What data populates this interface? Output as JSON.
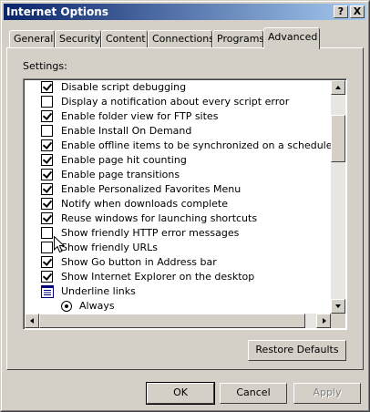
{
  "window": {
    "title": "Internet Options",
    "help_label": "?",
    "close_label": "X"
  },
  "tabs": [
    {
      "label": "General",
      "active": false
    },
    {
      "label": "Security",
      "active": false
    },
    {
      "label": "Content",
      "active": false
    },
    {
      "label": "Connections",
      "active": false
    },
    {
      "label": "Programs",
      "active": false
    },
    {
      "label": "Advanced",
      "active": true
    }
  ],
  "advanced": {
    "settings_label": "Settings:",
    "items": [
      {
        "type": "checkbox",
        "label": "Disable script debugging",
        "checked": true
      },
      {
        "type": "checkbox",
        "label": "Display a notification about every script error",
        "checked": false
      },
      {
        "type": "checkbox",
        "label": "Enable folder view for FTP sites",
        "checked": true
      },
      {
        "type": "checkbox",
        "label": "Enable Install On Demand",
        "checked": false
      },
      {
        "type": "checkbox",
        "label": "Enable offline items to be synchronized on a schedule",
        "checked": true
      },
      {
        "type": "checkbox",
        "label": "Enable page hit counting",
        "checked": true
      },
      {
        "type": "checkbox",
        "label": "Enable page transitions",
        "checked": true
      },
      {
        "type": "checkbox",
        "label": "Enable Personalized Favorites Menu",
        "checked": true
      },
      {
        "type": "checkbox",
        "label": "Notify when downloads complete",
        "checked": true
      },
      {
        "type": "checkbox",
        "label": "Reuse windows for launching shortcuts",
        "checked": true
      },
      {
        "type": "checkbox",
        "label": "Show friendly HTTP error messages",
        "checked": false
      },
      {
        "type": "checkbox",
        "label": "Show friendly URLs",
        "checked": false
      },
      {
        "type": "checkbox",
        "label": "Show Go button in Address bar",
        "checked": true
      },
      {
        "type": "checkbox",
        "label": "Show Internet Explorer on the desktop",
        "checked": true
      },
      {
        "type": "group",
        "label": "Underline links"
      },
      {
        "type": "radio",
        "label": "Always",
        "checked": true
      }
    ],
    "restore_defaults_label": "Restore Defaults"
  },
  "footer": {
    "ok_label": "OK",
    "cancel_label": "Cancel",
    "apply_label": "Apply"
  }
}
